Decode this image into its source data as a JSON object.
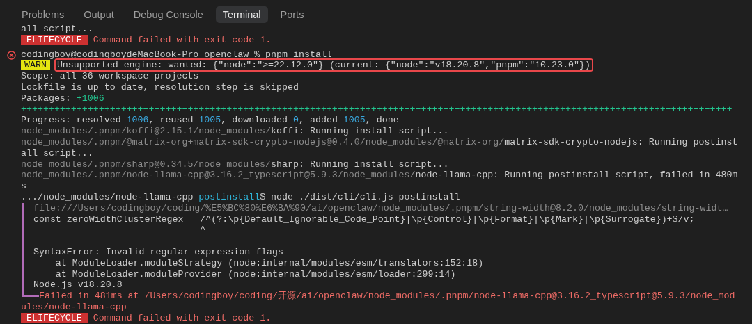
{
  "tabs": [
    {
      "label": "Problems",
      "selected": false
    },
    {
      "label": "Output",
      "selected": false
    },
    {
      "label": "Debug Console",
      "selected": false
    },
    {
      "label": "Terminal",
      "selected": true
    },
    {
      "label": "Ports",
      "selected": false
    }
  ],
  "terminal": {
    "lines": [
      {
        "segments": [
          {
            "kind": "text",
            "text": "all script..."
          }
        ]
      },
      {
        "segments": [
          {
            "kind": "error-badge",
            "text": "ELIFECYCLE"
          },
          {
            "kind": "red",
            "text": " Command failed with exit code 1."
          }
        ]
      },
      {
        "error_mark": true,
        "segments": [
          {
            "kind": "text",
            "text": "codingboy@codingboydeMacBook-Pro openclaw % pnpm install"
          }
        ]
      },
      {
        "segments": [
          {
            "kind": "warn-badge",
            "text": "WARN"
          },
          {
            "kind": "highlight",
            "text": "Unsupported engine: wanted: {\"node\":\">=22.12.0\"} (current: {\"node\":\"v18.20.8\",\"pnpm\":\"10.23.0\"})"
          }
        ]
      },
      {
        "segments": [
          {
            "kind": "text",
            "text": "Scope: all 36 workspace projects"
          }
        ]
      },
      {
        "segments": [
          {
            "kind": "text",
            "text": "Lockfile is up to date, resolution step is skipped"
          }
        ]
      },
      {
        "segments": [
          {
            "kind": "text",
            "text": "Packages: "
          },
          {
            "kind": "green",
            "text": "+1006"
          }
        ]
      },
      {
        "segments": [
          {
            "kind": "green",
            "text": "++++++++++++++++++++++++++++++++++++++++++++++++++++++++++++++++++++++++++++++++++++++++++++++++++++++++++++++++++++++++++++++++"
          }
        ]
      },
      {
        "segments": [
          {
            "kind": "text",
            "text": "Progress: resolved "
          },
          {
            "kind": "number",
            "text": "1006"
          },
          {
            "kind": "text",
            "text": ", reused "
          },
          {
            "kind": "number",
            "text": "1005"
          },
          {
            "kind": "text",
            "text": ", downloaded "
          },
          {
            "kind": "number",
            "text": "0"
          },
          {
            "kind": "text",
            "text": ", added "
          },
          {
            "kind": "number",
            "text": "1005"
          },
          {
            "kind": "text",
            "text": ", done"
          }
        ]
      },
      {
        "segments": [
          {
            "kind": "dim",
            "text": "node_modules/.pnpm/koffi@2.15.1/node_modules/"
          },
          {
            "kind": "text",
            "text": "koffi: Running install script..."
          }
        ]
      },
      {
        "segments": [
          {
            "kind": "dim",
            "text": "node_modules/.pnpm/@matrix-org+matrix-sdk-crypto-nodejs@0.4.0/node_modules/@matrix-org/"
          },
          {
            "kind": "text",
            "text": "matrix-sdk-crypto-nodejs: Running postinst"
          }
        ]
      },
      {
        "segments": [
          {
            "kind": "text",
            "text": "all script..."
          }
        ]
      },
      {
        "segments": [
          {
            "kind": "dim",
            "text": "node_modules/.pnpm/sharp@0.34.5/node_modules/"
          },
          {
            "kind": "text",
            "text": "sharp: Running install script..."
          }
        ]
      },
      {
        "segments": [
          {
            "kind": "dim",
            "text": "node_modules/.pnpm/node-llama-cpp@3.16.2_typescript@5.9.3/node_modules/"
          },
          {
            "kind": "text",
            "text": "node-llama-cpp: Running postinstall script, failed in 480m"
          }
        ]
      },
      {
        "segments": [
          {
            "kind": "text",
            "text": "s"
          }
        ]
      },
      {
        "segments": [
          {
            "kind": "text",
            "text": ".../node_modules/node-llama-cpp "
          },
          {
            "kind": "cyan",
            "text": "postinstall"
          },
          {
            "kind": "text",
            "text": "$ node ./dist/cli/cli.js postinstall"
          }
        ]
      },
      {
        "in_frame": true,
        "segments": [
          {
            "kind": "dim",
            "text": "file:///Users/codingboy/coding/%E5%BC%80%E6%BA%90/ai/openclaw/node_modules/.pnpm/string-width@8.2.0/node_modules/string-widt…"
          }
        ]
      },
      {
        "in_frame": true,
        "segments": [
          {
            "kind": "text",
            "text": "const zeroWidthClusterRegex = /^(?:\\p{Default_Ignorable_Code_Point}|\\p{Control}|\\p{Format}|\\p{Mark}|\\p{Surrogate})+$/v;"
          }
        ]
      },
      {
        "in_frame": true,
        "segments": [
          {
            "kind": "text",
            "text": "                              ^"
          }
        ]
      },
      {
        "in_frame": true
      },
      {
        "in_frame": true,
        "segments": [
          {
            "kind": "text",
            "text": "SyntaxError: Invalid regular expression flags"
          }
        ]
      },
      {
        "in_frame": true,
        "segments": [
          {
            "kind": "text",
            "text": "    at ModuleLoader.moduleStrategy (node:internal/modules/esm/translators:152:18)"
          }
        ]
      },
      {
        "in_frame": true,
        "segments": [
          {
            "kind": "text",
            "text": "    at ModuleLoader.moduleProvider (node:internal/modules/esm/loader:299:14)"
          }
        ]
      },
      {
        "in_frame": true,
        "segments": [
          {
            "kind": "text",
            "text": "Node.js v18.20.8"
          }
        ]
      },
      {
        "in_frame": true,
        "frame_end": true,
        "segments": [
          {
            "kind": "red",
            "text": "Failed in 481ms at /Users/codingboy/coding/开源/ai/openclaw/node_modules/.pnpm/node-llama-cpp@3.16.2_typescript@5.9.3/node_mod"
          }
        ]
      },
      {
        "segments": [
          {
            "kind": "red",
            "text": "ules/node-llama-cpp"
          }
        ]
      },
      {
        "segments": [
          {
            "kind": "error-badge",
            "text": "ELIFECYCLE"
          },
          {
            "kind": "red",
            "text": " Command failed with exit code 1."
          }
        ]
      }
    ]
  }
}
